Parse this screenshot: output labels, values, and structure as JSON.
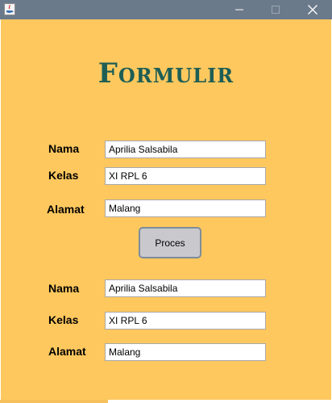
{
  "window": {
    "controls": {
      "minimize": "—",
      "maximize": "□",
      "close": "✕"
    },
    "colors": {
      "titlebar": "#6b7a8b",
      "background": "#fec85e",
      "title": "#1e5e55"
    }
  },
  "form": {
    "title": "Formulir",
    "inputs": [
      {
        "label": "Nama",
        "value": "Aprilia Salsabila"
      },
      {
        "label": "Kelas",
        "value": "XI RPL 6"
      },
      {
        "label": "Alamat",
        "value": "Malang"
      }
    ],
    "button_label": "Proces",
    "outputs": [
      {
        "label": "Nama",
        "value": "Aprilia Salsabila"
      },
      {
        "label": "Kelas",
        "value": "XI RPL 6"
      },
      {
        "label": "Alamat",
        "value": "Malang"
      }
    ]
  }
}
